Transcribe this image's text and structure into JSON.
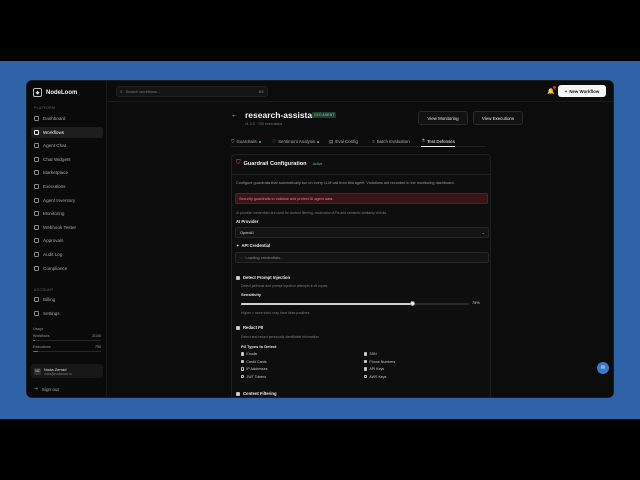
{
  "app": {
    "name": "NodeLoom",
    "colors": {
      "background_band": "#2f63a8",
      "accent_new": "#f5f5f5",
      "danger": "#e85a5a",
      "success": "#50c487"
    }
  },
  "sidebar": {
    "section_platform": "PLATFORM",
    "section_account": "ACCOUNT",
    "items": [
      {
        "label": "Dashboard",
        "icon": "grid-icon",
        "active": false
      },
      {
        "label": "Workflows",
        "icon": "flow-icon",
        "active": true
      },
      {
        "label": "Agent Chat",
        "icon": "chat-icon",
        "active": false
      },
      {
        "label": "Chat Widgets",
        "icon": "widget-icon",
        "active": false
      },
      {
        "label": "Marketplace",
        "icon": "store-icon",
        "active": false
      },
      {
        "label": "Executions",
        "icon": "play-icon",
        "active": false
      },
      {
        "label": "Agent Inventory",
        "icon": "box-icon",
        "active": false
      },
      {
        "label": "Monitoring",
        "icon": "chart-icon",
        "active": false
      },
      {
        "label": "Webhook Tester",
        "icon": "webhook-icon",
        "active": false
      },
      {
        "label": "Approvals",
        "icon": "check-icon",
        "active": false
      },
      {
        "label": "Audit Log",
        "icon": "log-icon",
        "active": false
      },
      {
        "label": "Compliance",
        "icon": "shield-icon",
        "active": false
      }
    ],
    "account_items": [
      {
        "label": "Billing",
        "icon": "card-icon"
      },
      {
        "label": "Settings",
        "icon": "gear-icon"
      }
    ],
    "usage": {
      "title": "Usage",
      "workflows_label": "Workflows",
      "workflows_value": "3/100",
      "workflows_fraction": 0.03,
      "executions_label": "Executions",
      "executions_value": "750",
      "executions_fraction": 0.08
    },
    "user": {
      "initials": "NZ",
      "name": "Noda Zerrad",
      "email": "noda@nodeloom.io"
    },
    "signout": "Sign out"
  },
  "topbar": {
    "search_placeholder": "Search workflows...",
    "search_shortcut": "⌘K",
    "new_workflow": "New Workflow"
  },
  "header": {
    "back": "←",
    "title": "research-assistant",
    "badge": "CEO AGENT",
    "meta": "v1.0.0 · 700 executions",
    "view_monitoring": "View Monitoring",
    "view_executions": "View Executions"
  },
  "tabs": [
    {
      "label": "Guardrails",
      "icon": "shield",
      "dot": true,
      "active": false
    },
    {
      "label": "Sentiment Analysis",
      "icon": "heart",
      "dot": true,
      "active": false
    },
    {
      "label": "Eval Config",
      "icon": "doc",
      "dot": false,
      "active": false
    },
    {
      "label": "Batch Evaluation",
      "icon": "layers",
      "dot": false,
      "active": false
    },
    {
      "label": "Test Defenses",
      "icon": "flask",
      "dot": false,
      "active": true
    }
  ],
  "panel": {
    "title": "Guardrail Configuration",
    "status": "Active",
    "description": "Configure guardrails that automatically run on every LLM call from this agent. Violations are recorded in the monitoring dashboard.",
    "alert": "Security guardrails to validate and protect AI agent data.",
    "note": "AI provider credentials are used for content filtering, moderation APIs and semantic similarity checks.",
    "ai_provider_label": "AI Provider",
    "ai_provider_value": "OpenAI",
    "api_credential_label": "API Credential",
    "api_credential_value": "Loading credentials...",
    "prompt_injection": {
      "label": "Detect Prompt Injection",
      "sub": "Detect jailbreak and prompt injection attempts in AI inputs",
      "sensitivity_label": "Sensitivity",
      "sensitivity_value": "75%",
      "sensitivity_fraction": 0.75,
      "hint": "Higher = more strict, may have false positives"
    },
    "pii": {
      "label": "Redact PII",
      "sub": "Detect and redact personally identifiable information",
      "types_label": "PII Types to Detect",
      "types": [
        {
          "label": "Emails",
          "checked": true
        },
        {
          "label": "SSN",
          "checked": true
        },
        {
          "label": "Credit Cards",
          "checked": true
        },
        {
          "label": "Phone Numbers",
          "checked": true
        },
        {
          "label": "IP Addresses",
          "checked": false
        },
        {
          "label": "API Keys",
          "checked": true
        },
        {
          "label": "JWT Tokens",
          "checked": false
        },
        {
          "label": "AWS Keys",
          "checked": false
        }
      ]
    },
    "content_filtering": "Content Filtering"
  }
}
